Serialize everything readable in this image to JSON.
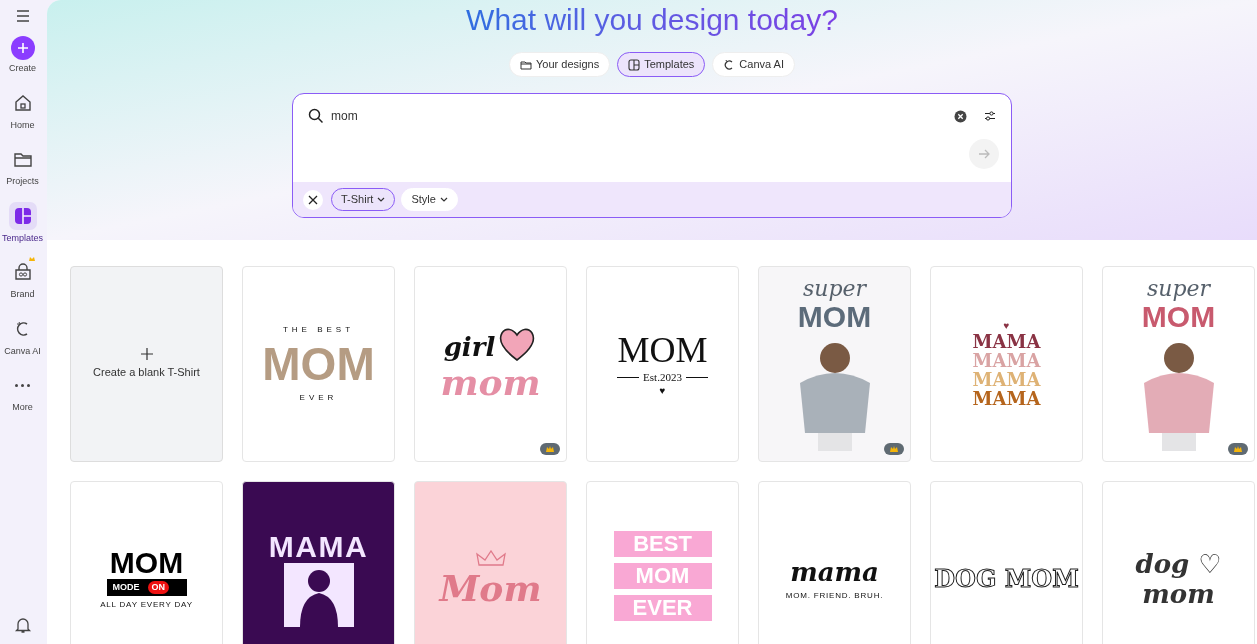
{
  "sidebar": {
    "items": [
      {
        "kind": "create",
        "label": "Create",
        "selected": false
      },
      {
        "kind": "home",
        "label": "Home",
        "selected": false
      },
      {
        "kind": "projects",
        "label": "Projects",
        "selected": false
      },
      {
        "kind": "templates",
        "label": "Templates",
        "selected": true
      },
      {
        "kind": "brand",
        "label": "Brand",
        "selected": false,
        "premium": true
      },
      {
        "kind": "ai",
        "label": "Canva AI",
        "selected": false
      },
      {
        "kind": "more",
        "label": "More",
        "selected": false
      }
    ]
  },
  "heading": "What will you design today?",
  "tabs": [
    {
      "kind": "folder",
      "label": "Your designs",
      "selected": false
    },
    {
      "kind": "templates",
      "label": "Templates",
      "selected": true
    },
    {
      "kind": "ai",
      "label": "Canva AI",
      "selected": false
    }
  ],
  "search": {
    "value": "mom"
  },
  "filters": [
    {
      "label": "T-Shirt",
      "selected": true
    },
    {
      "label": "Style",
      "selected": false
    }
  ],
  "templates": [
    {
      "kind": "blank",
      "label": "Create a blank T-Shirt"
    },
    {
      "kind": "text",
      "color": "#ffffff",
      "premium": false,
      "lines": [
        {
          "kind": "spaced",
          "text": "THE BEST"
        },
        {
          "kind": "photo-letters",
          "text": "MOM"
        },
        {
          "kind": "spaced",
          "text": "EVER"
        }
      ]
    },
    {
      "kind": "heart",
      "color": "#ffffff",
      "premium": true,
      "lines": [
        {
          "kind": "script",
          "text": "girl",
          "color": "#111111"
        },
        {
          "kind": "script-big",
          "text": "mom",
          "color": "#e58fa5"
        }
      ]
    },
    {
      "kind": "text",
      "color": "#ffffff",
      "premium": false,
      "lines": [
        {
          "kind": "serif-large",
          "text": "MOM"
        },
        {
          "kind": "serif-rule",
          "text": "Est.2023"
        },
        {
          "kind": "heart",
          "text": "♥",
          "color": "#111111"
        }
      ]
    },
    {
      "kind": "figure",
      "color": "#f7f6f8",
      "premium": true,
      "lines": [
        {
          "kind": "script-thin",
          "text": "super",
          "color": "#56606b"
        },
        {
          "kind": "bold-large",
          "text": "MOM",
          "color": "#5c6b7a"
        }
      ]
    },
    {
      "kind": "text",
      "color": "#ffffff",
      "premium": false,
      "lines": [
        {
          "kind": "heart",
          "text": "♥",
          "color": "#8a3344"
        },
        {
          "kind": "slab",
          "text": "MAMA",
          "color": "#8a3344"
        },
        {
          "kind": "slab",
          "text": "MAMA",
          "color": "#d9a3a3"
        },
        {
          "kind": "slab",
          "text": "MAMA",
          "color": "#deb275"
        },
        {
          "kind": "slab",
          "text": "MAMA",
          "color": "#b5651d"
        }
      ]
    },
    {
      "kind": "figure",
      "color": "#ffffff",
      "premium": true,
      "lines": [
        {
          "kind": "script-thin",
          "text": "super",
          "color": "#56606b"
        },
        {
          "kind": "bold-large",
          "text": "MOM",
          "color": "#c85a6e"
        }
      ]
    },
    {
      "kind": "text",
      "color": "#ffffff",
      "premium": false,
      "lines": [
        {
          "kind": "bold-large",
          "text": "MOM",
          "color": "#000000"
        },
        {
          "kind": "bar",
          "text": "MODE",
          "badge": "ON"
        },
        {
          "kind": "tiny",
          "text": "ALL DAY EVERY DAY"
        }
      ]
    },
    {
      "kind": "silhouette",
      "color": "#3a0a52",
      "premium": false,
      "lines": [
        {
          "kind": "groovy",
          "text": "MAMA",
          "color": "#f3e6ff"
        }
      ]
    },
    {
      "kind": "crown",
      "color": "#fbd3d8",
      "premium": false,
      "lines": [
        {
          "kind": "script-big",
          "text": "Mom",
          "color": "#e07a8a"
        }
      ]
    },
    {
      "kind": "text",
      "color": "#ffffff",
      "premium": false,
      "lines": [
        {
          "kind": "block",
          "text": "BEST"
        },
        {
          "kind": "block",
          "text": "MOM"
        },
        {
          "kind": "block",
          "text": "EVER"
        }
      ]
    },
    {
      "kind": "text",
      "color": "#ffffff",
      "premium": false,
      "lines": [
        {
          "kind": "script",
          "text": "mama",
          "color": "#111111"
        },
        {
          "kind": "tiny",
          "text": "MOM. FRIEND. BRUH."
        }
      ]
    },
    {
      "kind": "text",
      "color": "#ffffff",
      "premium": false,
      "lines": [
        {
          "kind": "outline",
          "text": "DOG MOM"
        }
      ]
    },
    {
      "kind": "text",
      "color": "#ffffff",
      "premium": false,
      "lines": [
        {
          "kind": "script",
          "text": "dog ♡",
          "color": "#333333"
        },
        {
          "kind": "script",
          "text": "mom",
          "color": "#333333"
        }
      ]
    }
  ]
}
